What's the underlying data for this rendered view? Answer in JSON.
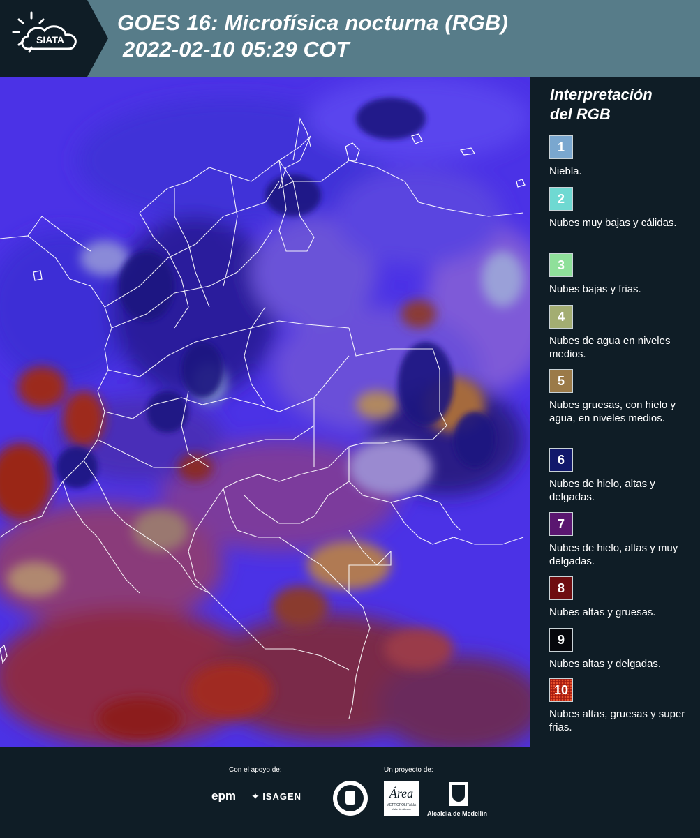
{
  "header": {
    "logo_text": "SIATA",
    "title_line1": "GOES 16: Microfísica nocturna (RGB)",
    "title_line2": "2022-02-10 05:29 COT"
  },
  "legend": {
    "title_line1": "Interpretación",
    "title_line2": "del RGB",
    "items": [
      {
        "number": "1",
        "label": "Niebla.",
        "color": "#7aa7cf"
      },
      {
        "number": "2",
        "label": "Nubes muy bajas y cálidas.",
        "color": "#6fd9d2"
      },
      {
        "number": "3",
        "label": "Nubes bajas y frias.",
        "color": "#8fe09a"
      },
      {
        "number": "4",
        "label": "Nubes de agua en niveles medios.",
        "color": "#a3ad72"
      },
      {
        "number": "5",
        "label": "Nubes gruesas, con hielo y agua, en niveles medios.",
        "color": "#9b7a48"
      },
      {
        "number": "6",
        "label": "Nubes de hielo, altas y delgadas.",
        "color": "#11186b"
      },
      {
        "number": "7",
        "label": "Nubes de hielo, altas y muy delgadas.",
        "color": "#5a1670"
      },
      {
        "number": "8",
        "label": "Nubes altas y gruesas.",
        "color": "#6e0d10"
      },
      {
        "number": "9",
        "label": "Nubes altas y delgadas.",
        "color": "#06070c"
      },
      {
        "number": "10",
        "label": "Nubes altas, gruesas y super frias.",
        "color": "#a71c10"
      }
    ]
  },
  "footer": {
    "support_label": "Con el apoyo de:",
    "project_label": "Un proyecto de:",
    "sponsor1": "epm",
    "sponsor2": "ISAGEN",
    "partner_area": "Área",
    "partner_area_sub": "METROPOLITANA",
    "partner_area_sub2": "Valle de Aburrá",
    "partner_alcaldia": "Alcaldía de Medellín"
  }
}
